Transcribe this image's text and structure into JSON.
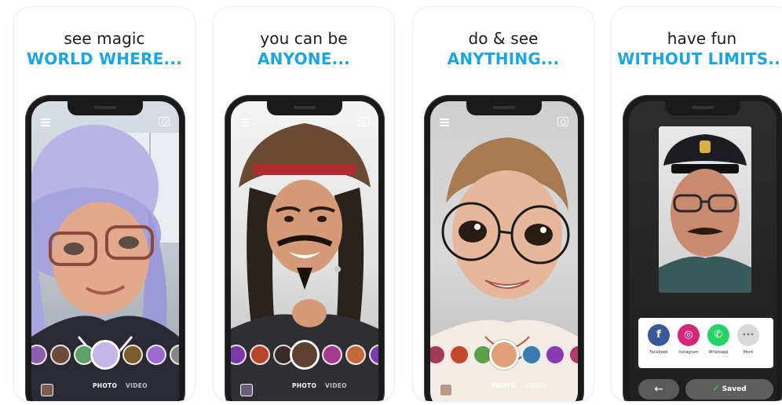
{
  "panels": [
    {
      "caption_top": "see magic",
      "caption_bottom": "WORLD WHERE...",
      "modes": {
        "photo": "PHOTO",
        "video": "VIDEO"
      }
    },
    {
      "caption_top": "you can be",
      "caption_bottom": "ANYONE...",
      "modes": {
        "photo": "PHOTO",
        "video": "VIDEO"
      }
    },
    {
      "caption_top": "do & see",
      "caption_bottom": "ANYTHING...",
      "modes": {
        "photo": "PHOTO",
        "video": "VIDEO"
      }
    },
    {
      "caption_top": "have fun",
      "caption_bottom": "WITHOUT LIMITS...",
      "share": {
        "facebook": {
          "label": "Facebook",
          "glyph": "f"
        },
        "instagram": {
          "label": "Instagram",
          "glyph": "◎"
        },
        "whatsapp": {
          "label": "Whatsapp",
          "glyph": "✆"
        },
        "more": {
          "label": "More",
          "glyph": "•••"
        }
      },
      "back_glyph": "←",
      "saved_label": "Saved"
    }
  ],
  "icons": [
    "menu-icon",
    "camera-flip-icon",
    "gallery-icon",
    "facebook-icon",
    "instagram-icon",
    "whatsapp-icon",
    "more-icon",
    "back-arrow-icon",
    "checkmark-icon"
  ],
  "colors": {
    "accent": "#19a6e6",
    "facebook": "#3b5998",
    "instagram": "#d6267a",
    "whatsapp": "#25d366",
    "more": "#d9d9d9"
  }
}
